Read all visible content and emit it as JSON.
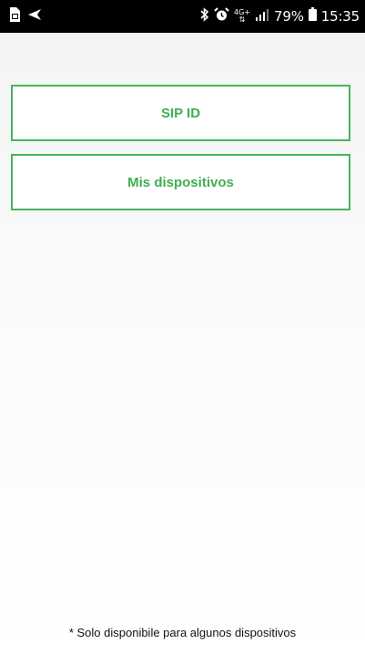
{
  "status_bar": {
    "network_label": "4G+",
    "battery_percent": "79%",
    "time": "15:35",
    "icons": [
      "sim-card-icon",
      "navigation-icon",
      "bluetooth-icon",
      "alarm-icon",
      "network-arrows-icon",
      "signal-icon",
      "battery-icon"
    ]
  },
  "menu": {
    "sip_id_label": "SIP ID",
    "devices_label": "Mis dispositivos"
  },
  "footer": {
    "note": "* Solo disponibile para algunos dispositivos"
  },
  "colors": {
    "accent": "#47b55a",
    "status_bar_bg": "#000000",
    "background": "#f5f5f5"
  }
}
